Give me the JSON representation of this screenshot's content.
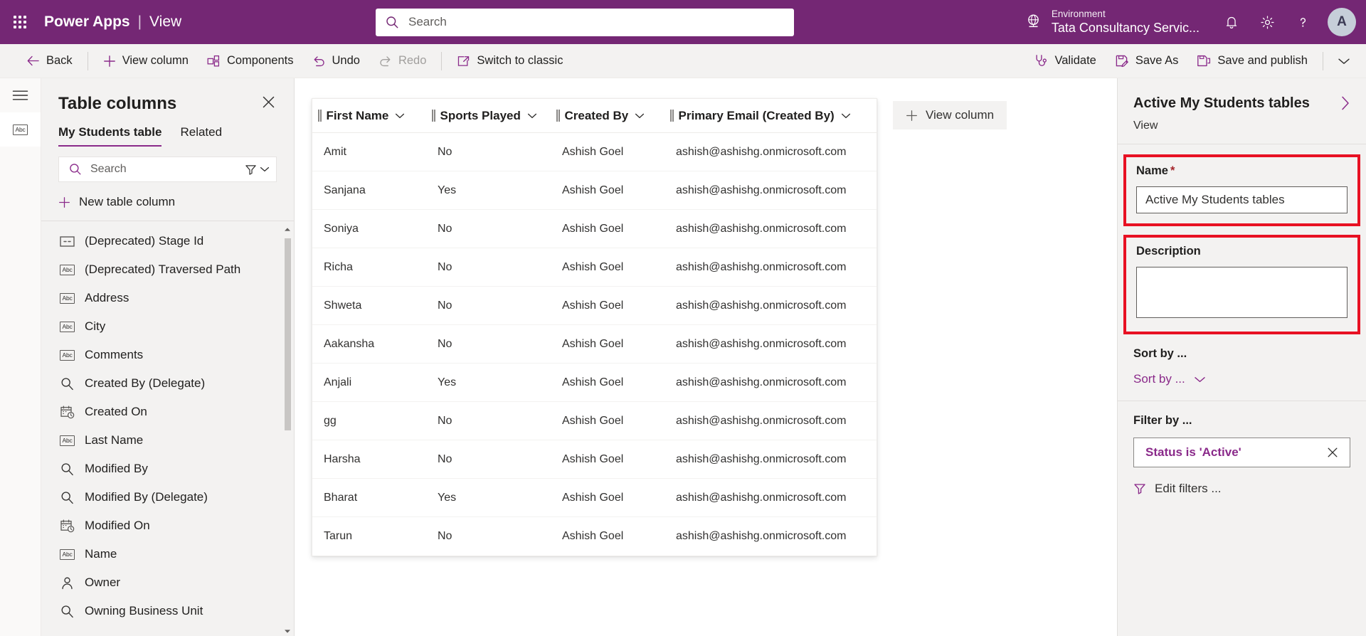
{
  "suitebar": {
    "waffle_label": "app-launcher",
    "brand": "Power Apps",
    "brand_separator": "|",
    "page_kind": "View",
    "search": {
      "value": "",
      "placeholder": "Search"
    },
    "environment": {
      "label": "Environment",
      "value": "Tata Consultancy Servic..."
    },
    "icons": {
      "notifications": "bell-icon",
      "settings": "gear-icon",
      "help": "help-icon"
    },
    "avatar_initial": "A",
    "accent": "#742774"
  },
  "commandbar": {
    "back": "Back",
    "view_column": "View column",
    "components": "Components",
    "undo": "Undo",
    "redo": "Redo",
    "switch_to_classic": "Switch to classic",
    "validate": "Validate",
    "save_as": "Save As",
    "save_and_publish": "Save and publish",
    "overflow": "chevron-down-icon",
    "redo_disabled": true
  },
  "rail": {
    "items": [
      {
        "name": "hamburger-menu",
        "icon": "hamburger-icon",
        "active": false
      },
      {
        "name": "table-columns",
        "icon": "abc-icon",
        "active": true
      }
    ]
  },
  "columns_panel": {
    "title": "Table columns",
    "close": "close-icon",
    "tabs": [
      {
        "label": "My Students table",
        "active": true
      },
      {
        "label": "Related",
        "active": false
      }
    ],
    "search": {
      "value": "",
      "placeholder": "Search"
    },
    "filter_icon": "filter-icon",
    "filter_chevron": "chevron-down-icon",
    "new_column": "New table column",
    "items": [
      {
        "label": "(Deprecated) Stage Id",
        "icon": "stage-id-icon"
      },
      {
        "label": "(Deprecated) Traversed Path",
        "icon": "abc-icon"
      },
      {
        "label": "Address",
        "icon": "abc-icon"
      },
      {
        "label": "City",
        "icon": "abc-icon"
      },
      {
        "label": "Comments",
        "icon": "abc-icon"
      },
      {
        "label": "Created By (Delegate)",
        "icon": "lookup-icon"
      },
      {
        "label": "Created On",
        "icon": "datetime-icon"
      },
      {
        "label": "Last Name",
        "icon": "abc-icon"
      },
      {
        "label": "Modified By",
        "icon": "lookup-icon"
      },
      {
        "label": "Modified By (Delegate)",
        "icon": "lookup-icon"
      },
      {
        "label": "Modified On",
        "icon": "datetime-icon"
      },
      {
        "label": "Name",
        "icon": "abc-icon"
      },
      {
        "label": "Owner",
        "icon": "owner-icon"
      },
      {
        "label": "Owning Business Unit",
        "icon": "lookup-icon"
      }
    ]
  },
  "grid": {
    "add_view_column": "View column",
    "headers": [
      {
        "label": "First Name"
      },
      {
        "label": "Sports Played"
      },
      {
        "label": "Created By"
      },
      {
        "label": "Primary Email (Created By)"
      }
    ],
    "rows": [
      {
        "first_name": "Amit",
        "sports_played": "No",
        "created_by": "Ashish Goel",
        "primary_email": "ashish@ashishg.onmicrosoft.com"
      },
      {
        "first_name": "Sanjana",
        "sports_played": "Yes",
        "created_by": "Ashish Goel",
        "primary_email": "ashish@ashishg.onmicrosoft.com"
      },
      {
        "first_name": "Soniya",
        "sports_played": "No",
        "created_by": "Ashish Goel",
        "primary_email": "ashish@ashishg.onmicrosoft.com"
      },
      {
        "first_name": "Richa",
        "sports_played": "No",
        "created_by": "Ashish Goel",
        "primary_email": "ashish@ashishg.onmicrosoft.com"
      },
      {
        "first_name": "Shweta",
        "sports_played": "No",
        "created_by": "Ashish Goel",
        "primary_email": "ashish@ashishg.onmicrosoft.com"
      },
      {
        "first_name": "Aakansha",
        "sports_played": "No",
        "created_by": "Ashish Goel",
        "primary_email": "ashish@ashishg.onmicrosoft.com"
      },
      {
        "first_name": "Anjali",
        "sports_played": "Yes",
        "created_by": "Ashish Goel",
        "primary_email": "ashish@ashishg.onmicrosoft.com"
      },
      {
        "first_name": "gg",
        "sports_played": "No",
        "created_by": "Ashish Goel",
        "primary_email": "ashish@ashishg.onmicrosoft.com"
      },
      {
        "first_name": "Harsha",
        "sports_played": "No",
        "created_by": "Ashish Goel",
        "primary_email": "ashish@ashishg.onmicrosoft.com"
      },
      {
        "first_name": "Bharat",
        "sports_played": "Yes",
        "created_by": "Ashish Goel",
        "primary_email": "ashish@ashishg.onmicrosoft.com"
      },
      {
        "first_name": "Tarun",
        "sports_played": "No",
        "created_by": "Ashish Goel",
        "primary_email": "ashish@ashishg.onmicrosoft.com"
      }
    ]
  },
  "properties": {
    "title": "Active My Students tables",
    "expand_icon": "chevron-right-icon",
    "subtitle": "View",
    "name_label": "Name",
    "name_required_mark": "*",
    "name_value": "Active My Students tables",
    "description_label": "Description",
    "description_value": "",
    "sort_by_label": "Sort by ...",
    "sort_by_value": "Sort by ...",
    "filter_by_label": "Filter by ...",
    "filter_pill": "Status is 'Active'",
    "filter_pill_remove": "close-icon",
    "edit_filters": "Edit filters ...",
    "highlight_color": "#e81123"
  }
}
